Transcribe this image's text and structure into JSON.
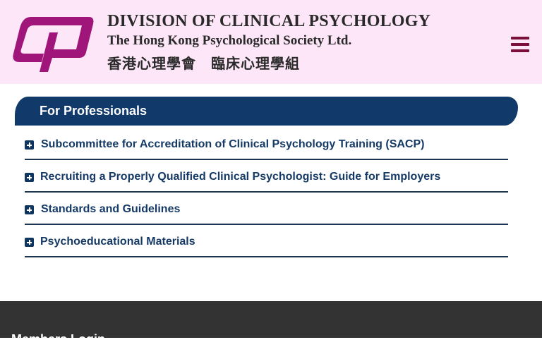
{
  "header": {
    "org_name_en": "DIVISION OF CLINICAL PSYCHOLOGY",
    "society_name_en": "The Hong Kong Psychological Society Ltd.",
    "org_name_zh": "香港心理學會　臨床心理學組",
    "menu_icon": "hamburger-menu-icon",
    "brand_color": "#a0157a"
  },
  "section": {
    "title": "For Professionals",
    "banner_color": "#113a6a"
  },
  "accordion": {
    "items": [
      {
        "label": "Subcommittee for Accreditation of Clinical Psychology Training (SACP)",
        "icon": "plus-square-icon"
      },
      {
        "label": "Recruiting a Properly Qualified Clinical Psychologist: Guide for Employers",
        "icon": "plus-square-icon"
      },
      {
        "label": "Standards and Guidelines",
        "icon": "plus-square-icon"
      },
      {
        "label": "Psychoeducational Materials",
        "icon": "plus-square-icon"
      }
    ]
  },
  "footer": {
    "title": "Members Login"
  }
}
